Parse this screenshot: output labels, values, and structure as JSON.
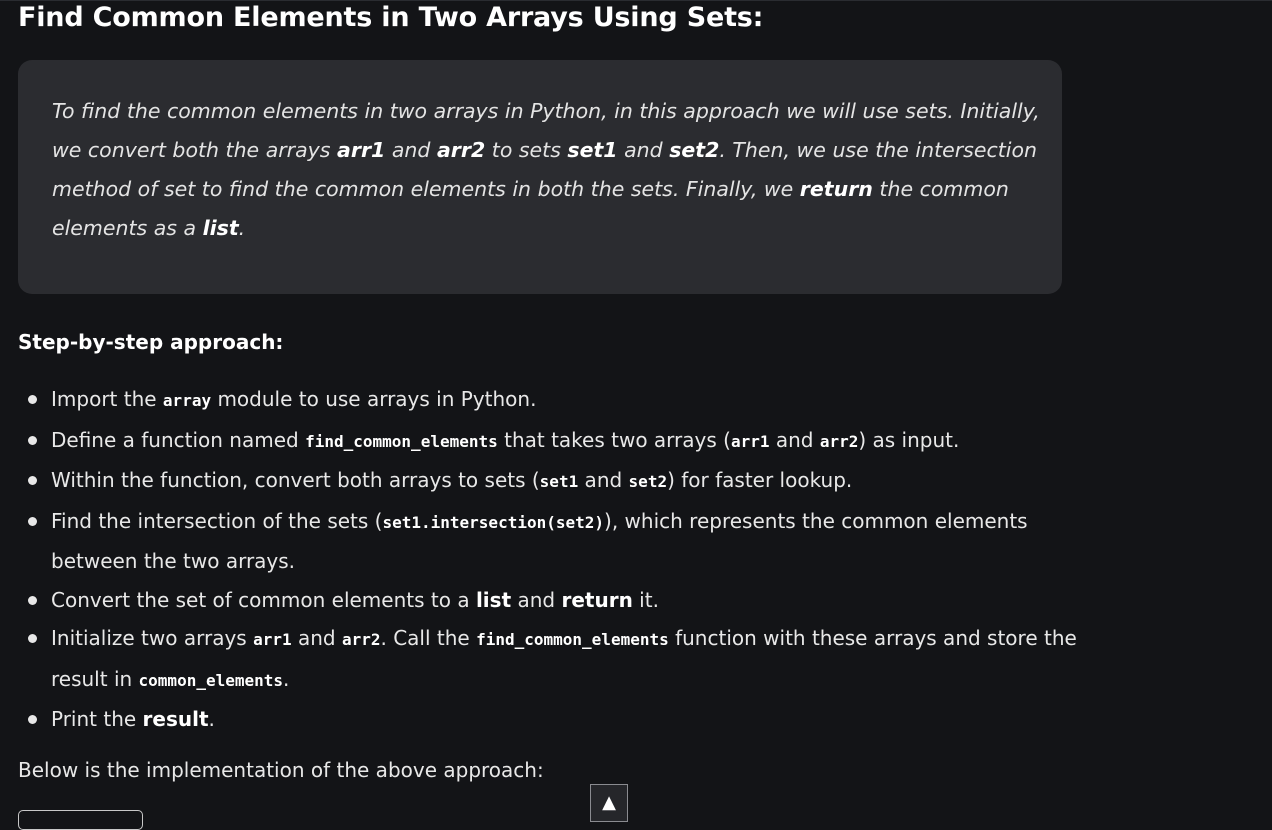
{
  "article": {
    "title": "Find Common Elements in Two Arrays Using Sets:",
    "callout": {
      "t1": "To find the common elements in two arrays in Python, in this approach we will use sets. Initially, we convert both the arrays ",
      "b1": "arr1",
      "t2": " and ",
      "b2": "arr2",
      "t3": " to sets ",
      "b3": "set1",
      "t4": " and ",
      "b4": "set2",
      "t5": ". Then, we use the intersection method of set to find the common elements in both the sets. Finally, we ",
      "b5": "return",
      "t6": " the common elements as a ",
      "b6": "list",
      "t7": "."
    },
    "subheading": "Step-by-step approach:",
    "steps": [
      {
        "a": "Import the ",
        "code": "array",
        "b": " module to use arrays in Python."
      },
      {
        "a": "Define a function named ",
        "code1": "find_common_elements",
        "b": " that takes two arrays (",
        "code2": "arr1",
        "c": " and ",
        "code3": "arr2",
        "d": ") as input."
      },
      {
        "a": "Within the function, convert both arrays to sets (",
        "code1": "set1",
        "b": " and ",
        "code2": "set2",
        "c": ") for faster lookup."
      },
      {
        "a": "Find the intersection of the sets (",
        "code": "set1.intersection(set2)",
        "b": "), which represents the common elements between the two arrays."
      },
      {
        "a": "Convert the set of common elements to a ",
        "s1": "list",
        "b": " and ",
        "s2": "return",
        "c": " it."
      },
      {
        "a": "Initialize two arrays ",
        "code1": "arr1",
        "b": " and ",
        "code2": "arr2",
        "c": ". Call the ",
        "code3": "find_common_elements",
        "d": " function with these arrays and store the result in ",
        "code4": "common_elements",
        "e": "."
      },
      {
        "a": "Print the ",
        "s1": "result",
        "b": "."
      }
    ],
    "footer_text": "Below is the implementation of the above approach:",
    "scroll_top_icon": "▲"
  }
}
